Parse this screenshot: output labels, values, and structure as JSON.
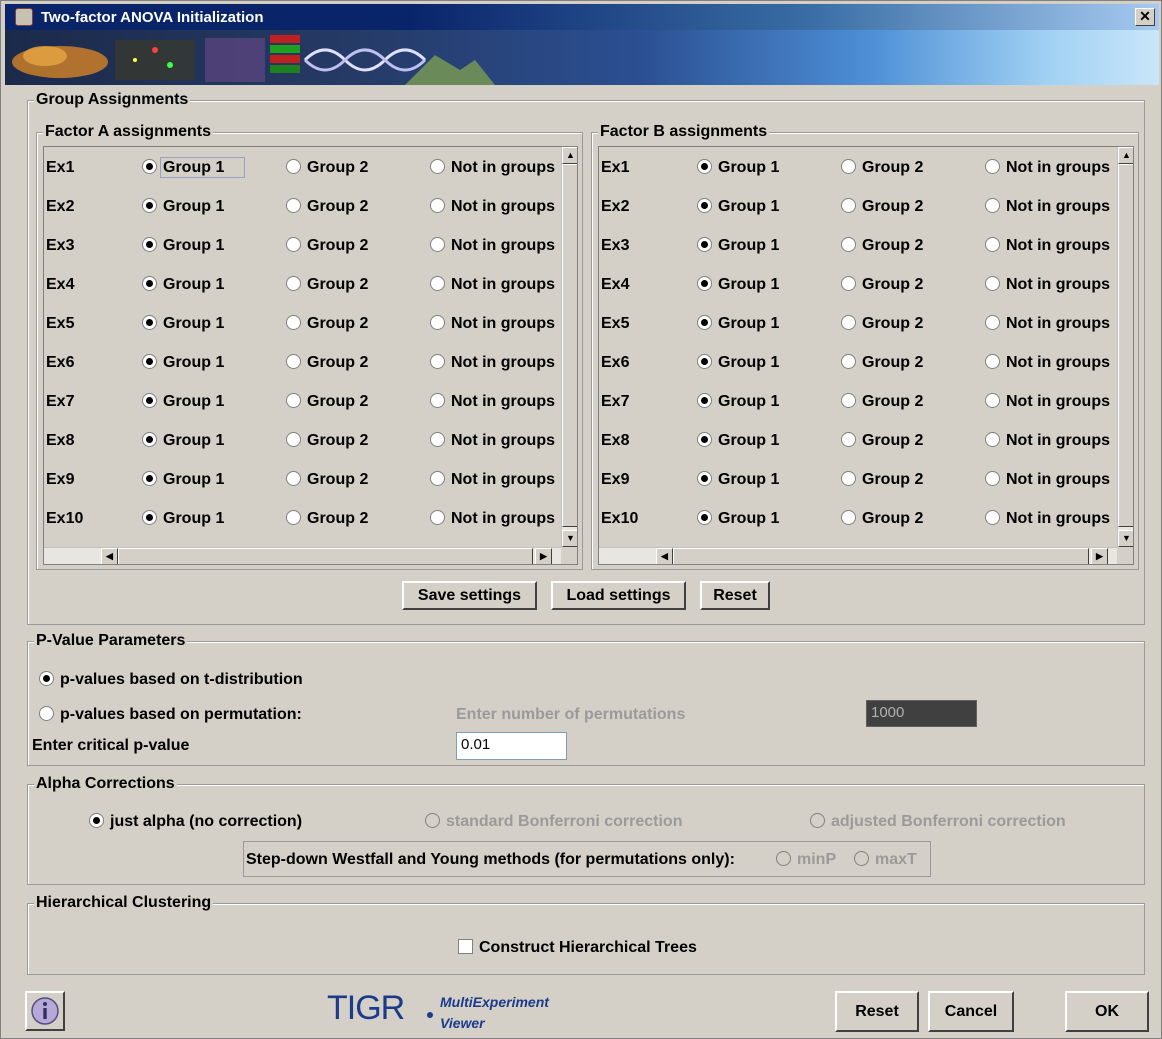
{
  "window": {
    "title": "Two-factor ANOVA Initialization",
    "close_glyph": "✕"
  },
  "group_assignments": {
    "legend": "Group Assignments",
    "factor_a": {
      "legend": "Factor A assignments",
      "rows": [
        {
          "label": "Ex1",
          "selected": "Group 1"
        },
        {
          "label": "Ex2",
          "selected": "Group 1"
        },
        {
          "label": "Ex3",
          "selected": "Group 1"
        },
        {
          "label": "Ex4",
          "selected": "Group 1"
        },
        {
          "label": "Ex5",
          "selected": "Group 1"
        },
        {
          "label": "Ex6",
          "selected": "Group 1"
        },
        {
          "label": "Ex7",
          "selected": "Group 1"
        },
        {
          "label": "Ex8",
          "selected": "Group 1"
        },
        {
          "label": "Ex9",
          "selected": "Group 1"
        },
        {
          "label": "Ex10",
          "selected": "Group 1"
        }
      ]
    },
    "factor_b": {
      "legend": "Factor B assignments",
      "rows": [
        {
          "label": "Ex1",
          "selected": "Group 1"
        },
        {
          "label": "Ex2",
          "selected": "Group 1"
        },
        {
          "label": "Ex3",
          "selected": "Group 1"
        },
        {
          "label": "Ex4",
          "selected": "Group 1"
        },
        {
          "label": "Ex5",
          "selected": "Group 1"
        },
        {
          "label": "Ex6",
          "selected": "Group 1"
        },
        {
          "label": "Ex7",
          "selected": "Group 1"
        },
        {
          "label": "Ex8",
          "selected": "Group 1"
        },
        {
          "label": "Ex9",
          "selected": "Group 1"
        },
        {
          "label": "Ex10",
          "selected": "Group 1"
        }
      ]
    },
    "options": [
      "Group 1",
      "Group 2",
      "Not in groups"
    ],
    "buttons": {
      "save": "Save settings",
      "load": "Load settings",
      "reset": "Reset"
    }
  },
  "pvalue": {
    "legend": "P-Value Parameters",
    "t_dist_label": "p-values based on t-distribution",
    "t_dist_selected": true,
    "perm_label": "p-values based on permutation:",
    "perm_count_label": "Enter number of permutations",
    "perm_count_value": "1000",
    "critical_label": "Enter critical p-value",
    "critical_value": "0.01"
  },
  "alpha": {
    "legend": "Alpha Corrections",
    "just_alpha": "just alpha (no correction)",
    "standard_bonf": "standard Bonferroni correction",
    "adjusted_bonf": "adjusted Bonferroni correction",
    "stepdown_label": "Step-down Westfall and Young methods (for permutations only):",
    "minp": "minP",
    "maxt": "maxT"
  },
  "hcl": {
    "legend": "Hierarchical Clustering",
    "checkbox_label": "Construct Hierarchical Trees",
    "checked": false
  },
  "footer": {
    "logo_text": "TIGR",
    "logo_sub_1": "MultiExperiment",
    "logo_sub_2": "Viewer",
    "reset": "Reset",
    "cancel": "Cancel",
    "ok": "OK"
  }
}
